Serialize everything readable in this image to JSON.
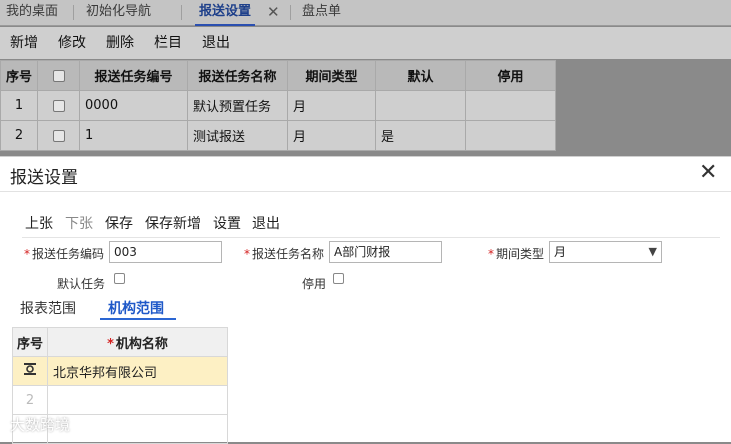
{
  "tabs": [
    {
      "label": "我的桌面"
    },
    {
      "label": "初始化导航"
    },
    {
      "label": "报送设置",
      "active": true
    },
    {
      "label": "盘点单"
    }
  ],
  "tab_close_glyph": "✕",
  "toolbar": {
    "new": "新增",
    "edit": "修改",
    "delete": "删除",
    "columns": "栏目",
    "exit": "退出"
  },
  "list_table": {
    "headers": [
      "序号",
      "",
      "报送任务编号",
      "报送任务名称",
      "期间类型",
      "默认",
      "停用"
    ],
    "rows": [
      {
        "no": "1",
        "code": "0000",
        "name": "默认预置任务",
        "period": "月",
        "default": "",
        "disabled": ""
      },
      {
        "no": "2",
        "code": "1",
        "name": "测试报送",
        "period": "月",
        "default": "是",
        "disabled": ""
      }
    ]
  },
  "dialog": {
    "title": "报送设置",
    "close_glyph": "✕",
    "buttons": {
      "prev": "上张",
      "next": "下张",
      "save": "保存",
      "save_new": "保存新增",
      "settings": "设置",
      "exit": "退出"
    },
    "fields": {
      "code_label": "报送任务编码",
      "code_value": "003",
      "name_label": "报送任务名称",
      "name_value": "A部门财报",
      "period_label": "期间类型",
      "period_value": "月",
      "default_label": "默认任务",
      "disabled_label": "停用"
    },
    "subtabs": {
      "report_scope": "报表范围",
      "org_scope": "机构范围"
    },
    "grid": {
      "headers": {
        "no": "序号",
        "org_name": "机构名称"
      },
      "rows": [
        {
          "no": "",
          "org_name": "北京华邦有限公司"
        },
        {
          "no": "2",
          "org_name": ""
        }
      ]
    }
  },
  "watermark": "大数跨境",
  "colors": {
    "accent": "#2b66d3",
    "required": "#d42020",
    "selected_row": "#fdf0c4"
  }
}
